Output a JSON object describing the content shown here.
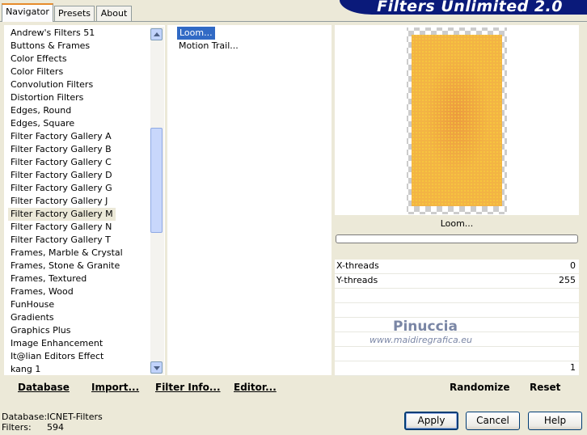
{
  "tabs": [
    {
      "label": "Navigator"
    },
    {
      "label": "Presets"
    },
    {
      "label": "About"
    }
  ],
  "banner_title": "Filters Unlimited 2.0",
  "categories": {
    "items": [
      "Andrew's Filters 51",
      "Buttons & Frames",
      "Color Effects",
      "Color Filters",
      "Convolution Filters",
      "Distortion Filters",
      "Edges, Round",
      "Edges, Square",
      "Filter Factory Gallery A",
      "Filter Factory Gallery B",
      "Filter Factory Gallery C",
      "Filter Factory Gallery D",
      "Filter Factory Gallery G",
      "Filter Factory Gallery J",
      "Filter Factory Gallery M",
      "Filter Factory Gallery N",
      "Filter Factory Gallery T",
      "Frames, Marble & Crystal",
      "Frames, Stone & Granite",
      "Frames, Textured",
      "Frames, Wood",
      "FunHouse",
      "Gradients",
      "Graphics Plus",
      "Image Enhancement",
      "It@lian Editors Effect",
      "kang 1"
    ],
    "selected": "Filter Factory Gallery M"
  },
  "filters": {
    "items": [
      "Loom...",
      "Motion Trail..."
    ],
    "selected": "Loom..."
  },
  "preview": {
    "filter_name": "Loom...",
    "colors": {
      "base": "#f3b444",
      "center": "#ee9d3d",
      "grid": "#f7d23a"
    }
  },
  "params": [
    {
      "label": "X-threads",
      "value": "0"
    },
    {
      "label": "Y-threads",
      "value": "255"
    },
    {
      "label": "",
      "value": ""
    },
    {
      "label": "",
      "value": ""
    },
    {
      "label": "",
      "value": ""
    },
    {
      "label": "",
      "value": ""
    },
    {
      "label": "",
      "value": ""
    },
    {
      "label": "",
      "value": "1"
    }
  ],
  "watermark": {
    "name": "Pinuccia",
    "url": "www.maidiregrafica.eu"
  },
  "toolbar": {
    "database": "Database",
    "import": "Import...",
    "filter_info": "Filter Info...",
    "editor": "Editor...",
    "randomize": "Randomize",
    "reset": "Reset"
  },
  "status": {
    "database_label": "Database:",
    "database_value": "ICNET-Filters",
    "filters_label": "Filters:",
    "filters_value": "594"
  },
  "buttons": {
    "apply": "Apply",
    "cancel": "Cancel",
    "help": "Help"
  }
}
